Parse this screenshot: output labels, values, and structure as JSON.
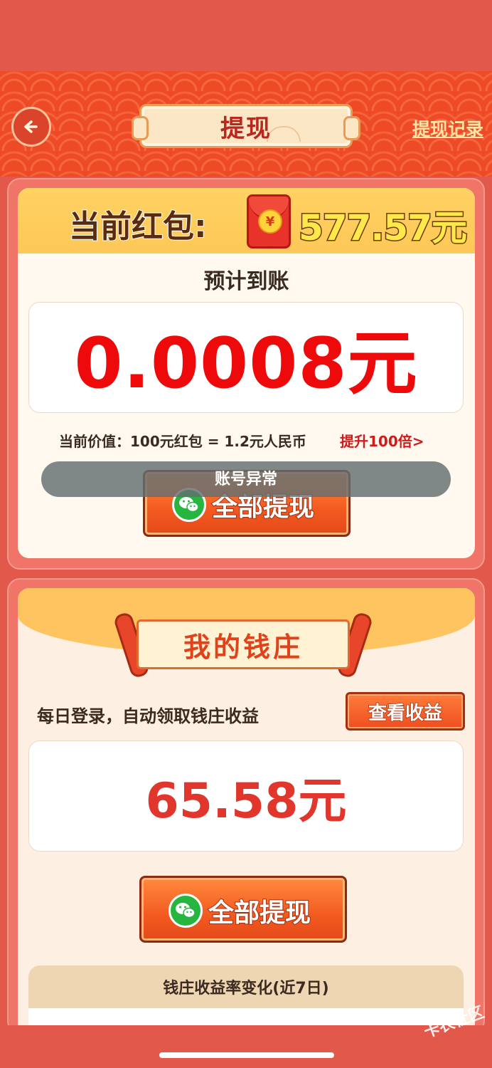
{
  "header": {
    "title": "提现",
    "record_link": "提现记录",
    "back_icon": "back-arrow-icon"
  },
  "redpacket": {
    "label": "当前红包:",
    "amount": "577.57元",
    "icon": "red-envelope-icon",
    "coin_symbol": "¥"
  },
  "expected": {
    "label": "预计到账",
    "amount": "0.0008元"
  },
  "value_info": {
    "text": "当前价值：100元红包 = 1.2元人民币",
    "boost_link": "提升100倍>"
  },
  "withdraw_button": {
    "label": "全部提现",
    "icon": "wechat-icon"
  },
  "toast": {
    "text": "账号异常"
  },
  "bank": {
    "title": "我的钱庄",
    "login_text": "每日登录，自动领取钱庄收益",
    "check_button": "查看收益",
    "amount": "65.58元",
    "withdraw_label": "全部提现",
    "rate_title": "钱庄收益率变化(近7日)"
  },
  "watermark": "卡农社区",
  "colors": {
    "accent_red": "#ee0a0a",
    "header_red": "#ee4a26",
    "gold": "#ffe94a",
    "background": "#e2584a"
  }
}
